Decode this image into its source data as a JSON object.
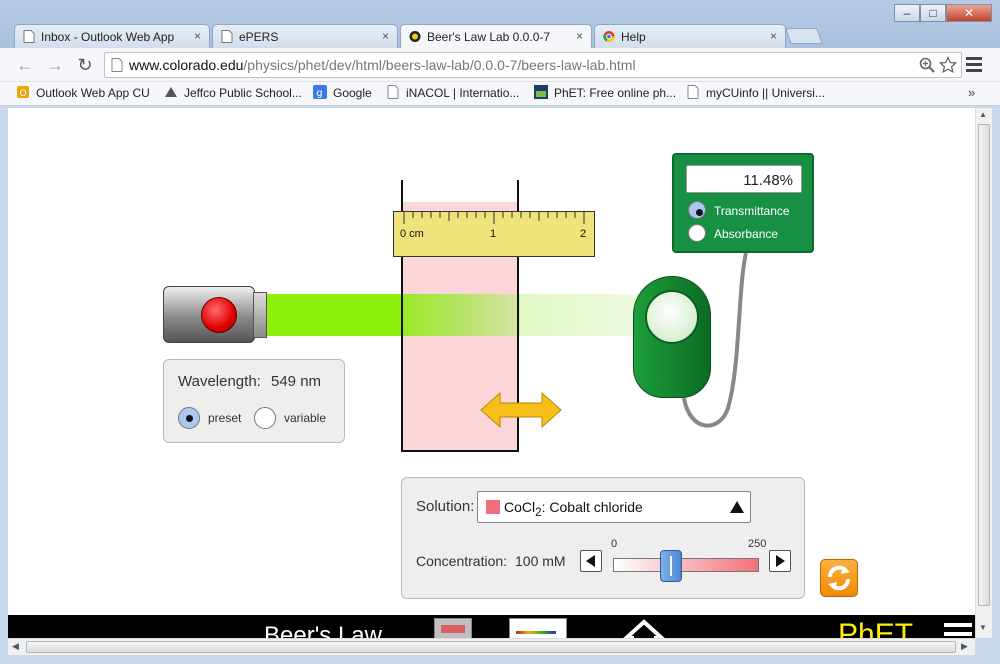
{
  "browser": {
    "tabs": [
      {
        "title": "Inbox - Outlook Web App",
        "close": "×"
      },
      {
        "title": "ePERS",
        "close": "×"
      },
      {
        "title": "Beer's Law Lab 0.0.0-7",
        "close": "×"
      },
      {
        "title": "Help",
        "close": "×"
      }
    ],
    "url_host": "www.colorado.edu",
    "url_path": "/physics/phet/dev/html/beers-law-lab/0.0.0-7/beers-law-lab.html",
    "window_buttons": {
      "minimize": "–",
      "maximize": "□",
      "close": "✕"
    },
    "bookmarks": [
      "Outlook Web App CU",
      "Jeffco Public School...",
      "Google",
      "iNACOL | Internatio...",
      "PhET: Free online ph...",
      "myCUinfo || Universi..."
    ],
    "bookmarks_more": "»"
  },
  "sim": {
    "wavelength_label": "Wavelength:",
    "wavelength_value": "549 nm",
    "preset_label": "preset",
    "variable_label": "variable",
    "wavelength_mode": "preset",
    "ruler_labels": [
      "0 cm",
      "1",
      "2"
    ],
    "meter_value": "11.48%",
    "transmittance_label": "Transmittance",
    "absorbance_label": "Absorbance",
    "meter_mode": "transmittance",
    "solution_label": "Solution:",
    "solution_formula": "CoCl",
    "solution_subscript": "2",
    "solution_name": ": Cobalt chloride",
    "solution_color": "#f26d7d",
    "concentration_label": "Concentration:",
    "concentration_value": "100 mM",
    "slider_min": "0",
    "slider_max": "250",
    "slider_fraction": 0.4,
    "beam_color": "#88ee00",
    "navbar_title": "Beer's Law",
    "phet_logo": "PhET"
  }
}
